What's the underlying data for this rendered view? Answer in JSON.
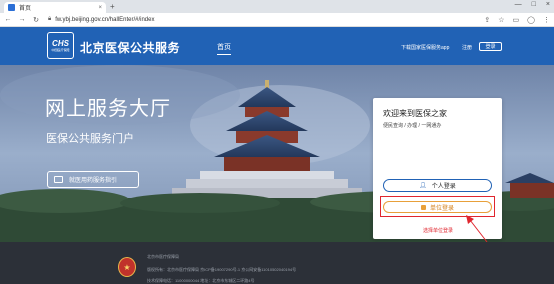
{
  "browser": {
    "tab_title": "首页",
    "tab_close": "×",
    "new_tab": "+",
    "url": "fw.ybj.beijing.gov.cn/hallEnter/#/index",
    "win_controls": [
      "—",
      "□",
      "×"
    ],
    "nav_icons": [
      "back-icon",
      "forward-icon",
      "reload-icon"
    ]
  },
  "header": {
    "logo_abbr": "CHS",
    "logo_sub": "中国医疗保障",
    "site_name": "北京医保公共服务",
    "nav_home": "首页",
    "download_app": "下载国家医保服务app",
    "register": "注册",
    "login": "登录"
  },
  "hero": {
    "title": "网上服务大厅",
    "subtitle": "医保公共服务门户",
    "guide_button": "就医用药服务指引"
  },
  "card": {
    "title": "欢迎来到医保之家",
    "subtitle": "便民查询 / 办理 / 一网通办",
    "personal_login": "个人登录",
    "unit_login": "单位登录",
    "select_unit_hint": "选择单位登录"
  },
  "footer": {
    "org": "北京市医疗保障局",
    "line2": "版权所有：北京市医疗保障局  京ICP备19007290号-1  京公网安备11010502040194号",
    "line3": "技术保障电话：11000000044  地址：北京市东城区二环路4号"
  },
  "colors": {
    "header_blue": "#2162b5",
    "unit_orange": "#e8a03a",
    "highlight_red": "#e0262e",
    "footer_dark": "#2c3038"
  }
}
